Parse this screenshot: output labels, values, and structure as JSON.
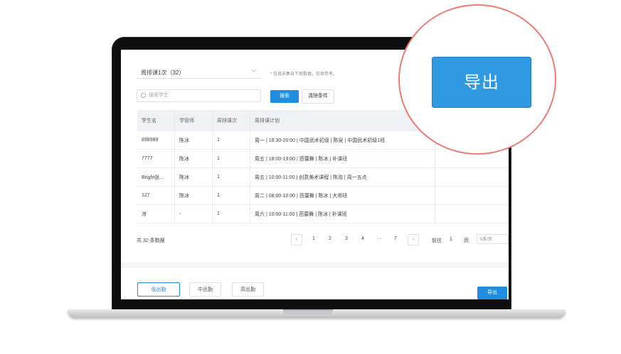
{
  "filter": {
    "select_value": "周排课1次（32）",
    "hint": "* 信息采集自下周数据，仅供参考。",
    "search_placeholder": "搜索学生",
    "search_button": "搜索",
    "clear_button": "清除条件"
  },
  "table": {
    "headers": [
      "学生名",
      "学管师",
      "周排课次",
      "周排课计划"
    ],
    "rows": [
      [
        "898989",
        "陈冰",
        "1",
        "周一 | 18:30-20:00 | 中国武术初级 | 陈泉 | 中国武术初级1班"
      ],
      [
        "7777",
        "陈冰",
        "1",
        "周五 | 18:00-19:00 | 芭蕾舞 | 陈冰 | 补课班"
      ],
      [
        "Bright张...",
        "陈冰",
        "1",
        "周五 | 10:00-11:00 | 创意美术课程 | 陈泡 | 周一五点"
      ],
      [
        "127",
        "陈冰",
        "1",
        "周二 | 08:00-10:00 | 芭蕾舞 | 陈冰 | 大师班"
      ],
      [
        "凉",
        "-",
        "1",
        "周六 | 10:00-11:00 | 芭蕾舞 | 陈冰 | 补课班"
      ]
    ]
  },
  "pagination": {
    "total": "共 32 条数据",
    "prev": "‹",
    "pages": [
      "1",
      "2",
      "3",
      "4",
      "···",
      "7"
    ],
    "next": "›",
    "goto_label": "前往",
    "goto_value": "1",
    "page_unit": "页",
    "page_size": "5条/页"
  },
  "bottom_tabs": {
    "low": "低出勤",
    "mid": "中出勤",
    "high": "高出勤"
  },
  "export_label": "导出",
  "zoom_export_label": "导出",
  "colors": {
    "accent": "#1f8ce0",
    "zoom_ring": "#ef7a74"
  }
}
